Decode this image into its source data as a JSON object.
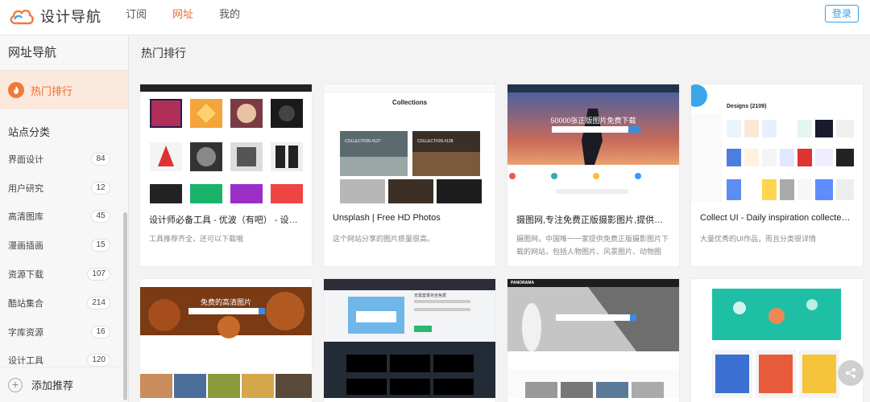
{
  "header": {
    "logo_text": "设计导航",
    "nav": [
      "订阅",
      "网址",
      "我的"
    ],
    "active_nav": 1,
    "login": "登录",
    "accent": "#f06a2e",
    "login_color": "#3aa0e6"
  },
  "sidebar": {
    "title": "网址导航",
    "hot": "热门排行",
    "category_header": "站点分类",
    "categories": [
      {
        "label": "界面设计",
        "count": "84"
      },
      {
        "label": "用户研究",
        "count": "12"
      },
      {
        "label": "高清图库",
        "count": "45"
      },
      {
        "label": "漫画插画",
        "count": "15"
      },
      {
        "label": "资源下载",
        "count": "107"
      },
      {
        "label": "酷站集合",
        "count": "214"
      },
      {
        "label": "字库资源",
        "count": "16"
      },
      {
        "label": "设计工具",
        "count": "120"
      }
    ],
    "add": "添加推荐"
  },
  "main": {
    "title": "热门排行",
    "cards": [
      {
        "title": "设计师必备工具 - 优波（有吧） - 设计师...",
        "desc": "工具推荐齐全，还可以下载哦"
      },
      {
        "title": "Unsplash | Free HD Photos",
        "desc": "这个网站分享的图片质量很高。",
        "thumb_text": "Collections",
        "tags": [
          "COLLECTION #127",
          "COLLECTION #128"
        ]
      },
      {
        "title": "摄图网,专注免费正版摄影图片,提供免费...",
        "desc": "摄图网，中国唯一一家提供免费正版摄影图片下载的网站，包括人物图片、风景图片、动物图片，建",
        "thumb_text": "50000张正版图片免费下载"
      },
      {
        "title": "Collect UI - Daily inspiration collected fro...",
        "desc": "大量优秀的UI作品，而且分类很详情",
        "thumb_text": "Designs (2109)"
      },
      {
        "title": "",
        "desc": "",
        "thumb_text": "免费的高清图片"
      },
      {
        "title": "",
        "desc": "",
        "thumb_text": "无需登录完全免费"
      },
      {
        "title": "",
        "desc": "",
        "thumb_text": "PANORAMA"
      },
      {
        "title": "",
        "desc": "",
        "thumb_text": ""
      }
    ]
  }
}
